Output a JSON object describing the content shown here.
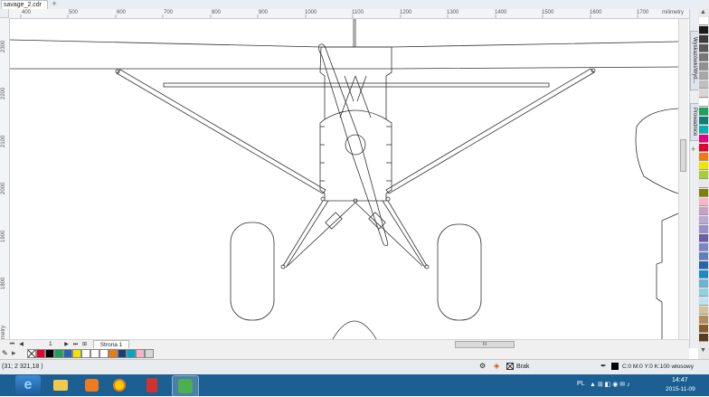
{
  "document_tab": {
    "title": "savage_2.cdr",
    "new_tab_glyph": "+"
  },
  "ruler": {
    "unit": "milimetry",
    "h_labels": [
      "400",
      "500",
      "600",
      "700",
      "800",
      "900",
      "1000",
      "1100",
      "1200",
      "1300",
      "1400",
      "1500",
      "1600",
      "1700"
    ],
    "v_labels": [
      "2300",
      "2200",
      "2100",
      "2000",
      "1900",
      "1800"
    ]
  },
  "page_nav": {
    "first": "⏮",
    "prev": "◀",
    "counter": "1 z 1",
    "next": "▶",
    "last": "⏭",
    "add_page": "⊞",
    "page_tab": "Strona 1"
  },
  "dockers": {
    "tab1": "Wyskazówki/Wyd...",
    "tab2": "Prowadnice",
    "plus": "+"
  },
  "status": {
    "coords": "(31; 2 321,18 )",
    "fill_label": "Brak",
    "outline_label": "C:0 M:0 Y:0 K:100 włosowy"
  },
  "taskbar": {
    "lang": "PL",
    "time": "14:47",
    "date": "2015-11-09"
  },
  "colors": {
    "palette": [
      "#ffffff",
      "#1a1a1a",
      "#3a3a3a",
      "#5a5a5a",
      "#777777",
      "#909090",
      "#a8a8a8",
      "#bfbfbf",
      "#d6d6d6",
      "#ffffff",
      "#1aa15a",
      "#0f7e76",
      "#00b3b3",
      "#e4007f",
      "#e6002d",
      "#ee7b0f",
      "#f4e300",
      "#a6ce39",
      "#e8e8e8",
      "#808000",
      "#f7b6c8",
      "#c7a0c8",
      "#b9a7d6",
      "#9b8dc8",
      "#6a5fa8",
      "#7a86c8",
      "#5f7fbf",
      "#2b64ae",
      "#1b8bc6",
      "#66b4d8",
      "#8fd0e4",
      "#bde3ee",
      "#d4c09a",
      "#b48b5a",
      "#8b5a2b",
      "#5c3b1e"
    ],
    "bottom_swatches": [
      "#ffffff",
      "#e6002d",
      "#000000",
      "#1aa15a",
      "#2b64ae",
      "#f4e300",
      "#1aa15a",
      "#ffffff",
      "#0f7e76",
      "#ffffff",
      "#ee7b0f",
      "#1b3f7a",
      "#00a7c7",
      "#f7b6c8",
      "#d6d6d6"
    ]
  }
}
